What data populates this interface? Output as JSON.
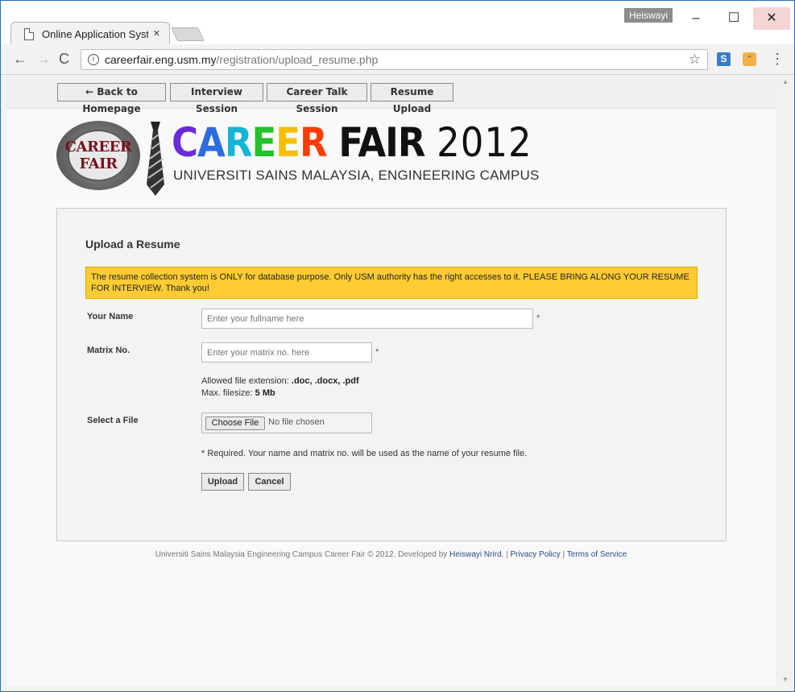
{
  "browser": {
    "tab_title": "Online Application System",
    "tab_close": "×",
    "user_badge": "Heiswayi",
    "win_min": "–",
    "win_max": "☐",
    "win_close": "✕",
    "url_domain": "careerfair.eng.usm.my",
    "url_path": "/registration/upload_resume.php",
    "info_icon": "i",
    "star_icon": "☆",
    "ext_s": "S",
    "ext_face": "ᵔ",
    "menu_icon": "⋮",
    "back_icon": "←",
    "fwd_icon": "→",
    "reload_icon": "C"
  },
  "nav": {
    "items": [
      {
        "label": "← Back to Homepage"
      },
      {
        "label": "Interview Session"
      },
      {
        "label": "Career Talk Session"
      },
      {
        "label": "Resume Upload"
      }
    ]
  },
  "header": {
    "logo_text": "CAREER FAIR",
    "brand_letters": [
      "C",
      "A",
      "R",
      "E",
      "E",
      "R"
    ],
    "brand_colors": [
      "#6a2bd9",
      "#2d6be0",
      "#13b5d5",
      "#22c22a",
      "#f3c000",
      "#ff3b00"
    ],
    "brand_word2": "FAIR",
    "brand_year": "2012",
    "subtitle": "UNIVERSITI SAINS MALAYSIA, ENGINEERING CAMPUS"
  },
  "form": {
    "title": "Upload a Resume",
    "notice": "The resume collection system is ONLY for database purpose. Only USM authority has the right accesses to it. PLEASE BRING ALONG YOUR RESUME FOR INTERVIEW. Thank you!",
    "name_label": "Your Name",
    "name_placeholder": "Enter your fullname here",
    "matrix_label": "Matrix No.",
    "matrix_placeholder": "Enter your matrix no. here",
    "required_mark": "*",
    "allowed_ext_label": "Allowed file extension:",
    "allowed_ext_value": ".doc, .docx, .pdf",
    "max_size_label": "Max. filesize:",
    "max_size_value": "5 Mb",
    "file_label": "Select a File",
    "choose_file": "Choose File",
    "no_file": "No file chosen",
    "required_note": "* Required. Your name and matrix no. will be used as the name of your resume file.",
    "upload_button": "Upload",
    "cancel_button": "Cancel"
  },
  "footer": {
    "text": "Universiti Sains Malaysia Engineering Campus Career Fair © 2012. Developed by",
    "developer": "Heiswayi Nrird.",
    "sep1": "|",
    "privacy": "Privacy Policy",
    "sep2": "|",
    "terms": "Terms of Service"
  }
}
